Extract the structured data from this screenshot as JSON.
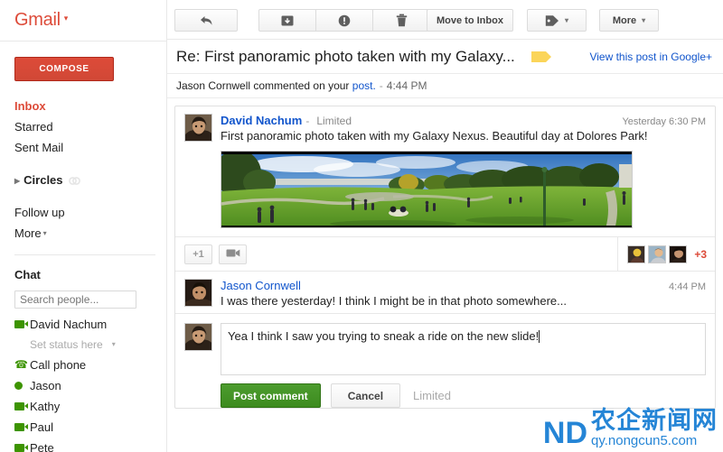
{
  "app": {
    "brand": "Gmail",
    "brand_caret": "▾",
    "brand_color": "#dd4b39"
  },
  "sidebar": {
    "compose_label": "COMPOSE",
    "nav": [
      {
        "label": "Inbox",
        "state": "active"
      },
      {
        "label": "Starred",
        "state": "normal"
      },
      {
        "label": "Sent Mail",
        "state": "normal"
      },
      {
        "label": "Circles",
        "state": "bold",
        "has_expander": true,
        "has_circle_icon": true
      },
      {
        "label": "Follow up",
        "state": "normal"
      },
      {
        "label": "More",
        "state": "normal",
        "has_caret": true
      }
    ],
    "chat": {
      "title": "Chat",
      "search_placeholder": "Search people...",
      "search_value": "",
      "me": {
        "name": "David Nachum",
        "presence": "video"
      },
      "status_placeholder": "Set status here",
      "status_caret": "▾",
      "contacts": [
        {
          "name": "Call phone",
          "presence": "phone"
        },
        {
          "name": "Jason",
          "presence": "available"
        },
        {
          "name": "Kathy",
          "presence": "video"
        },
        {
          "name": "Paul",
          "presence": "video"
        },
        {
          "name": "Pete",
          "presence": "video"
        }
      ]
    }
  },
  "toolbar": {
    "back_icon": "back-arrow-icon",
    "archive_icon": "archive-icon",
    "spam_icon": "spam-exclamation-icon",
    "delete_icon": "trash-icon",
    "move_to_inbox_label": "Move to Inbox",
    "labels_icon": "label-tag-icon",
    "labels_caret": "▾",
    "more_label": "More",
    "more_caret": "▾"
  },
  "thread": {
    "subject": "Re: First panoramic photo taken with my Galaxy...",
    "label_chip_color": "#fbd55a",
    "view_post_link": "View this post in Google+",
    "notice": {
      "prefix": "Jason Cornwell commented on your",
      "link": "post.",
      "separator": "-",
      "time": "4:44 PM"
    },
    "post": {
      "author": "David Nachum",
      "dash": "-",
      "audience": "Limited",
      "timestamp": "Yesterday 6:30 PM",
      "text": "First panoramic photo taken with my Galaxy Nexus. Beautiful day at Dolores Park!",
      "photo_alt": "Panoramic photo of Dolores Park"
    },
    "plus_bar": {
      "plus_one_label": "+1",
      "hangout_icon": "video-camera-icon",
      "extra_count": "+3"
    },
    "comment": {
      "author": "Jason Cornwell",
      "timestamp": "4:44 PM",
      "text": "I was there yesterday! I think I might be in that photo somewhere..."
    },
    "compose": {
      "value": "Yea I think I saw you trying to sneak a ride on the new slide!",
      "post_label": "Post comment",
      "cancel_label": "Cancel",
      "audience_label": "Limited"
    }
  },
  "watermark": {
    "mark": "ND",
    "chinese": "农企新闻网",
    "url": "qy.nongcun5.com",
    "color": "#1a7fd4"
  }
}
